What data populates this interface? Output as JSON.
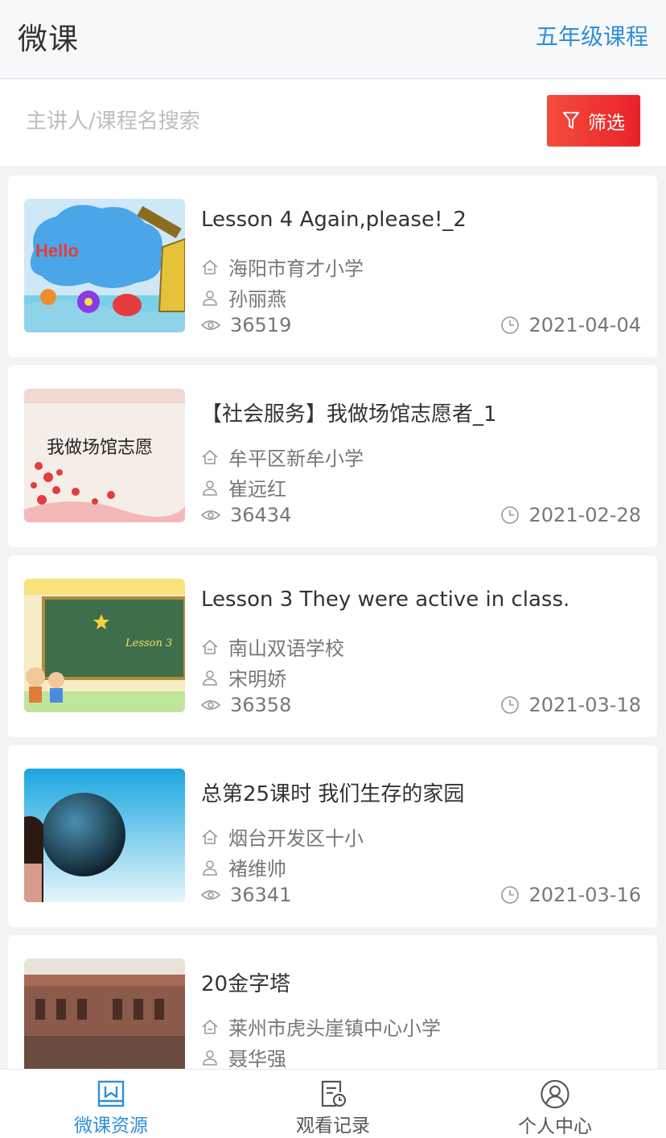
{
  "header": {
    "title": "微课",
    "grade_link": "五年级课程"
  },
  "search": {
    "placeholder": "主讲人/课程名搜索",
    "filter_label": "筛选"
  },
  "courses": [
    {
      "title": "Lesson 4 Again,please!_2",
      "school": "海阳市育才小学",
      "teacher": "孙丽燕",
      "views": "36519",
      "date": "2021-04-04",
      "thumb_text": "Hello"
    },
    {
      "title": "【社会服务】我做场馆志愿者_1",
      "school": "牟平区新牟小学",
      "teacher": "崔远红",
      "views": "36434",
      "date": "2021-02-28",
      "thumb_text": "我做场馆志愿"
    },
    {
      "title": "Lesson 3 They were active in class.",
      "school": "南山双语学校",
      "teacher": "宋明娇",
      "views": "36358",
      "date": "2021-03-18",
      "thumb_text": "Lesson 3"
    },
    {
      "title": "总第25课时 我们生存的家园",
      "school": "烟台开发区十小",
      "teacher": "褚维帅",
      "views": "36341",
      "date": "2021-03-16",
      "thumb_text": ""
    },
    {
      "title": "20金字塔",
      "school": "莱州市虎头崖镇中心小学",
      "teacher": "聂华强",
      "views": "",
      "date": "",
      "thumb_text": ""
    }
  ],
  "tabbar": {
    "items": [
      {
        "label": "微课资源",
        "icon": "bookmark-book-icon",
        "active": true
      },
      {
        "label": "观看记录",
        "icon": "history-record-icon",
        "active": false
      },
      {
        "label": "个人中心",
        "icon": "user-profile-icon",
        "active": false
      }
    ]
  },
  "colors": {
    "accent": "#2f8fd8",
    "filter_button": "#e8232a"
  }
}
